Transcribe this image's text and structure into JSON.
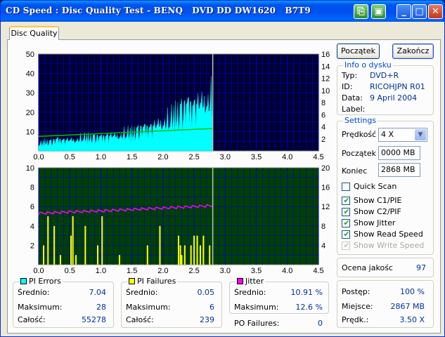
{
  "window": {
    "title": "CD Speed : Disc Quality Test - BENQ   DVD DD DW1620   B7T9"
  },
  "tabs": [
    {
      "label": "Disc Quality"
    }
  ],
  "buttons": {
    "start": "Początek",
    "stop": "Zakończ"
  },
  "disc_info": {
    "legend": "Info o dysku",
    "rows": [
      {
        "label": "Typ:",
        "value": "DVD+R"
      },
      {
        "label": "ID:",
        "value": "RICOHJPN R01"
      },
      {
        "label": "Data:",
        "value": "9 April 2004"
      },
      {
        "label": "Label:",
        "value": ""
      }
    ]
  },
  "settings": {
    "legend": "Settings",
    "speed_label": "Prędkość",
    "speed_value": "4 X",
    "start_label": "Początek",
    "start_value": "0000 MB",
    "end_label": "Koniec",
    "end_value": "2868 MB",
    "checkboxes": [
      {
        "label": "Quick Scan",
        "checked": false,
        "disabled": false
      },
      {
        "label": "Show C1/PIE",
        "checked": true,
        "disabled": false
      },
      {
        "label": "Show C2/PIF",
        "checked": true,
        "disabled": false
      },
      {
        "label": "Show Jitter",
        "checked": true,
        "disabled": false
      },
      {
        "label": "Show Read Speed",
        "checked": true,
        "disabled": false
      },
      {
        "label": "Show Write Speed",
        "checked": true,
        "disabled": true
      }
    ]
  },
  "quality": {
    "label": "Ocena jakośc",
    "value": "97"
  },
  "progress": {
    "rows": [
      {
        "label": "Postęp:",
        "value": "100 %"
      },
      {
        "label": "Miejsce:",
        "value": "2867 MB"
      },
      {
        "label": "Prędk.:",
        "value": "3.50 X"
      }
    ]
  },
  "stats": {
    "pi_errors": {
      "legend": "PI Errors",
      "color": "#00ffff",
      "rows": [
        {
          "label": "Średnio:",
          "value": "7.04"
        },
        {
          "label": "Maksimum:",
          "value": "28"
        },
        {
          "label": "Całość:",
          "value": "55278"
        }
      ]
    },
    "pi_failures": {
      "legend": "PI Failures",
      "color": "#ffff00",
      "rows": [
        {
          "label": "Średnio:",
          "value": "0.05"
        },
        {
          "label": "Maksimum:",
          "value": "6"
        },
        {
          "label": "Całość:",
          "value": "239"
        }
      ]
    },
    "jitter": {
      "legend": "Jitter",
      "color": "#ff00ff",
      "rows": [
        {
          "label": "Średnio:",
          "value": "10.91 %"
        },
        {
          "label": "Maksimum:",
          "value": "12.6 %"
        }
      ]
    },
    "po_failures": {
      "label": "PO Failures:",
      "value": "0"
    }
  },
  "chart_data": [
    {
      "type": "area",
      "xlim": [
        0,
        4.5
      ],
      "ylim_left": [
        0,
        50
      ],
      "ylim_right": [
        0,
        16
      ],
      "x_ticks": [
        "0.0",
        "0.5",
        "1.0",
        "1.5",
        "2.0",
        "2.5",
        "3.0",
        "3.5",
        "4.0",
        "4.5"
      ],
      "y_ticks_left": [
        "10",
        "20",
        "30",
        "40",
        "50"
      ],
      "y_ticks_right": [
        "2",
        "4",
        "6",
        "8",
        "10",
        "12",
        "14",
        "16"
      ],
      "scan_end": 2.8,
      "series": [
        {
          "name": "PI Errors",
          "color": "#00ffff",
          "x": [
            0,
            0.1,
            0.2,
            0.3,
            0.4,
            0.5,
            0.6,
            0.7,
            0.8,
            0.9,
            1.0,
            1.1,
            1.2,
            1.3,
            1.4,
            1.5,
            1.6,
            1.7,
            1.8,
            1.9,
            2.0,
            2.1,
            2.2,
            2.3,
            2.4,
            2.5,
            2.6,
            2.7,
            2.8
          ],
          "values": [
            3,
            4,
            4,
            5,
            5,
            5,
            5,
            6,
            6,
            6,
            6,
            7,
            7,
            7,
            8,
            8,
            9,
            10,
            11,
            12,
            13,
            14,
            16,
            18,
            20,
            21,
            22,
            23,
            24
          ]
        },
        {
          "name": "Read Speed",
          "color": "#00c000",
          "x": [
            0,
            2.8
          ],
          "values": [
            2.4,
            3.7
          ]
        }
      ]
    },
    {
      "type": "bar",
      "xlim": [
        0,
        4.5
      ],
      "ylim_left": [
        0,
        10
      ],
      "ylim_right": [
        0,
        20
      ],
      "x_ticks": [
        "0.0",
        "0.5",
        "1.0",
        "1.5",
        "2.0",
        "2.5",
        "3.0",
        "3.5",
        "4.0",
        "4.5"
      ],
      "y_ticks_left": [
        "2",
        "4",
        "6",
        "8",
        "10"
      ],
      "y_ticks_right": [
        "4",
        "8",
        "12",
        "16",
        "20"
      ],
      "scan_end": 2.8,
      "series": [
        {
          "name": "PI Failures",
          "color": "#ffff00",
          "x": [
            0.08,
            0.15,
            0.25,
            0.35,
            0.52,
            0.55,
            0.6,
            0.75,
            0.95,
            1.02,
            1.3,
            1.75,
            1.95,
            2.25,
            2.28,
            2.3,
            2.35,
            2.45,
            2.5,
            2.55,
            2.6,
            2.65,
            2.75
          ],
          "values": [
            2,
            5,
            4,
            1,
            3,
            5,
            1,
            4,
            2,
            5,
            1,
            2,
            4,
            3,
            2,
            1,
            2,
            2,
            3,
            3,
            2,
            3,
            2
          ]
        },
        {
          "name": "Jitter",
          "color": "#ff00ff",
          "x": [
            0,
            0.5,
            1.0,
            1.5,
            2.0,
            2.5,
            2.8
          ],
          "values": [
            10.6,
            10.9,
            11.1,
            11.4,
            11.7,
            12.0,
            12.2
          ]
        }
      ]
    }
  ]
}
